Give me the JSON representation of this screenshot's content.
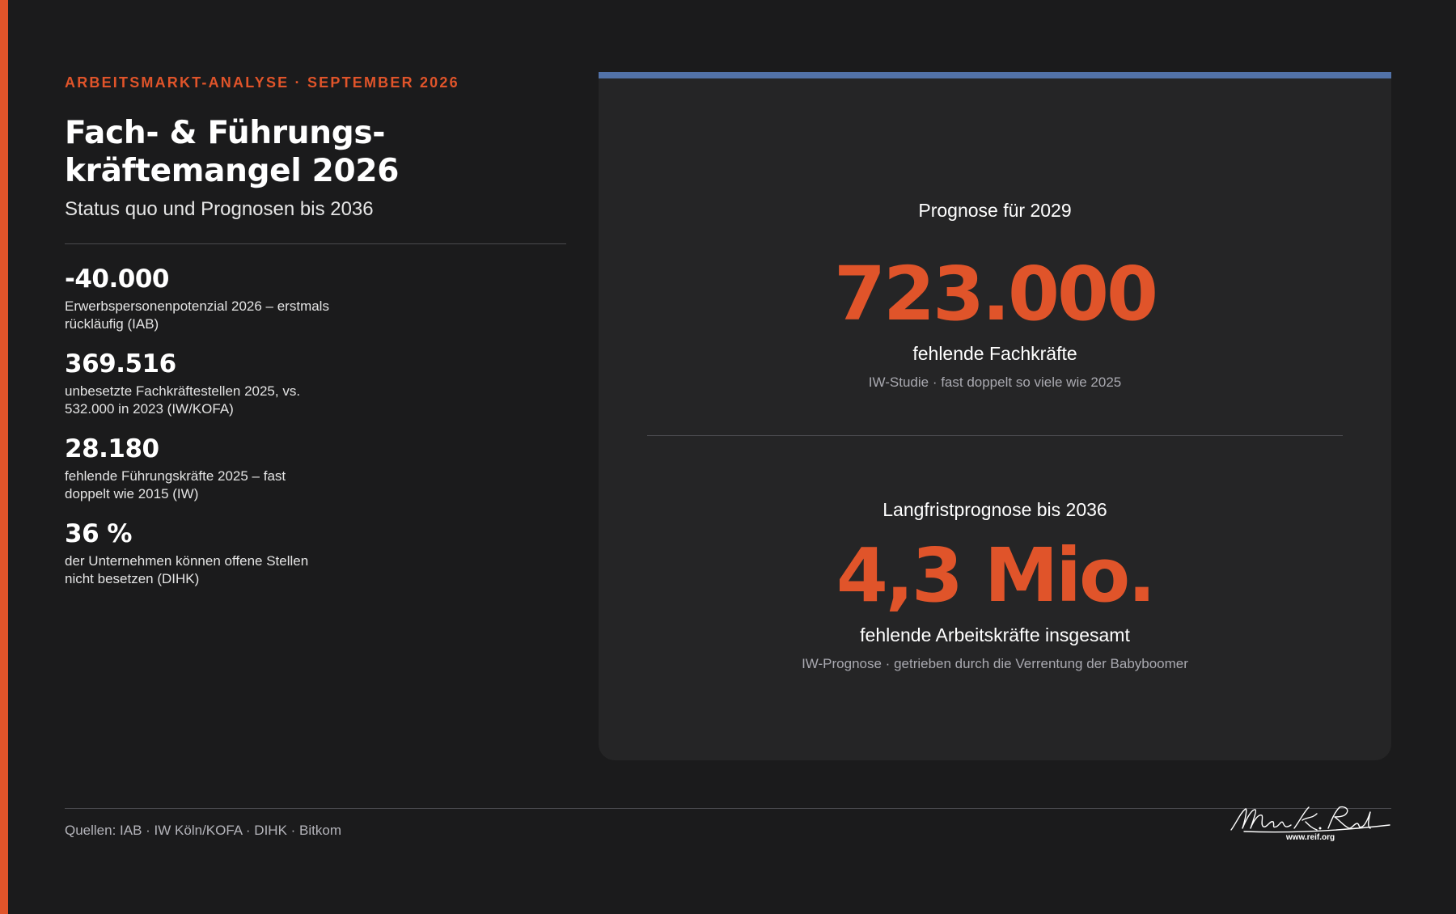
{
  "header": {
    "eyebrow": "ARBEITSMARKT-ANALYSE · SEPTEMBER 2026",
    "title_line1": "Fach- & Führungs-",
    "title_line2": "kräftemangel 2026",
    "subtitle": "Status quo und Prognosen bis 2036"
  },
  "stats": [
    {
      "value": "-40.000",
      "desc_line1": "Erwerbspersonenpotenzial 2026 – erstmals",
      "desc_line2": "rückläufig (IAB)"
    },
    {
      "value": "369.516",
      "desc_line1": "unbesetzte Fachkräftestellen 2025, vs.",
      "desc_line2": "532.000 in 2023 (IW/KOFA)"
    },
    {
      "value": "28.180",
      "desc_line1": "fehlende Führungskräfte 2025 – fast",
      "desc_line2": "doppelt wie 2015 (IW)"
    },
    {
      "value": "36 %",
      "desc_line1": "der Unternehmen können offene Stellen",
      "desc_line2": "nicht besetzen (DIHK)"
    }
  ],
  "card": {
    "forecast_2029": {
      "label": "Prognose für 2029",
      "value": "723.000",
      "caption": "fehlende Fachkräfte",
      "source": "IW-Studie · fast doppelt so viele wie 2025"
    },
    "forecast_2036": {
      "label": "Langfristprognose bis 2036",
      "value": "4,3 Mio.",
      "caption": "fehlende Arbeitskräfte insgesamt",
      "source": "IW-Prognose · getrieben durch die Verrentung der Babyboomer"
    }
  },
  "footer": {
    "sources": "Quellen: IAB · IW Köln/KOFA · DIHK · Bitkom",
    "signature_name": "Marcus K. Reif",
    "signature_url": "www.reif.org"
  },
  "colors": {
    "accent": "#e0542a",
    "card_topline": "#5272a8",
    "background": "#1b1b1c",
    "card_background": "#252526"
  }
}
